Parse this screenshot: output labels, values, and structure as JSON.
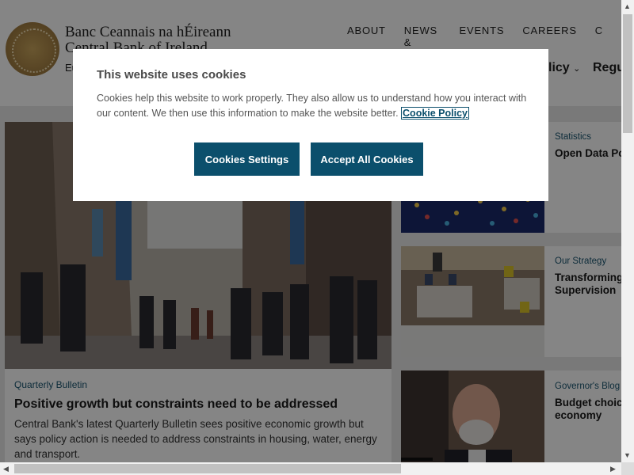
{
  "header": {
    "brand_irish": "Banc Ceannais na hÉireann",
    "brand_english": "Central Bank of Ireland",
    "brand_sub": "Eu",
    "top_nav": [
      "ABOUT",
      "NEWS & MEDIA",
      "EVENTS",
      "CAREERS",
      "C"
    ],
    "main_nav": [
      {
        "label": "licy",
        "chevron": "chevron-down-icon"
      },
      {
        "label": "Regu",
        "chevron": ""
      }
    ]
  },
  "hero": {
    "tag": "Quarterly Bulletin",
    "title": "Positive growth but constraints need to be addressed",
    "text": "Central Bank's latest Quarterly Bulletin sees positive economic growth but says policy action is needed to address constraints in housing, water, energy and transport."
  },
  "cards": [
    {
      "tag": "Statistics",
      "title": "Open Data Po"
    },
    {
      "tag": "Our Strategy",
      "title": "Transforming Supervision"
    },
    {
      "tag": "Governor's Blog",
      "title": "Budget choice economy"
    }
  ],
  "cookie_modal": {
    "title": "This website uses cookies",
    "text": "Cookies help this website to work properly. They also allow us to understand how you interact with our content. We then use this information to make the website better.",
    "policy_link": "Cookie Policy",
    "settings_button": "Cookies Settings",
    "accept_button": "Accept All Cookies"
  },
  "scrollbars": {
    "up": "▲",
    "down": "▼",
    "left": "◀",
    "right": "▶"
  },
  "colors": {
    "accent": "#0b4f6c",
    "tag": "#1a5570",
    "overlay": "rgba(0,0,0,0.48)"
  }
}
